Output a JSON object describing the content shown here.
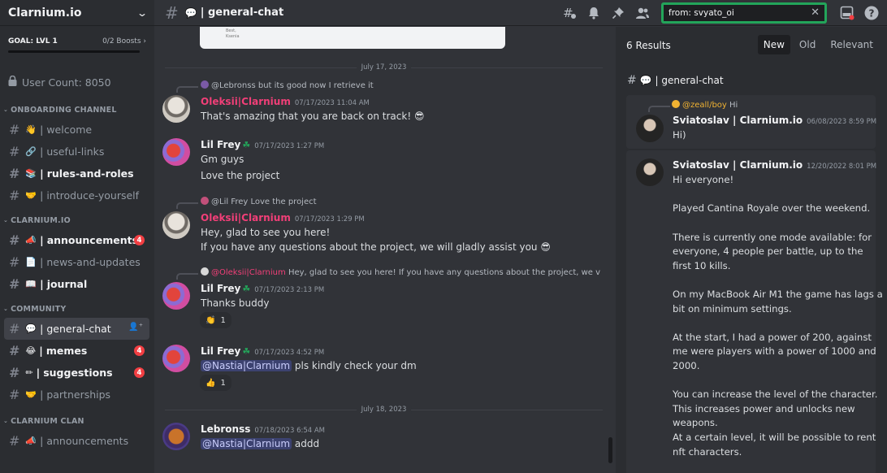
{
  "server": {
    "name": "Clarnium.io"
  },
  "goal": {
    "label": "GOAL: LVL 1",
    "boosts": "0/2 Boosts"
  },
  "user_count": "User Count: 8050",
  "categories": {
    "onboarding": "ONBOARDING CHANNEL",
    "clarnium": "CLARNIUM.IO",
    "community": "COMMUNITY",
    "clan": "CLARNIUM CLAN"
  },
  "channels": [
    {
      "emoji": "👋",
      "name": "welcome"
    },
    {
      "emoji": "🔗",
      "name": "useful-links"
    },
    {
      "emoji": "📚",
      "name": "rules-and-roles"
    },
    {
      "emoji": "🤝",
      "name": "introduce-yourself"
    },
    {
      "emoji": "📣",
      "name": "announcements",
      "badge": "4"
    },
    {
      "emoji": "📄",
      "name": "news-and-updates"
    },
    {
      "emoji": "📖",
      "name": "journal"
    },
    {
      "emoji": "💬",
      "name": "general-chat"
    },
    {
      "emoji": "😂",
      "name": "memes",
      "badge": "4"
    },
    {
      "emoji": "✏",
      "name": "suggestions",
      "badge": "4"
    },
    {
      "emoji": "🤝",
      "name": "partnerships"
    },
    {
      "emoji": "📣",
      "name": "announcements"
    }
  ],
  "topbar": {
    "channel_emoji": "💬",
    "channel_title": "| general-chat",
    "search_query": "from: svyato_oi"
  },
  "chat": {
    "embed_lines": [
      "Best,",
      "Ksenia"
    ],
    "date_1": "July 17, 2023",
    "date_2": "July 18, 2023",
    "messages": [
      {
        "reply": "@Lebronss but its good now I retrieve it",
        "author": "Oleksii|Clarnium",
        "time": "07/17/2023 11:04 AM",
        "lines": [
          "That's amazing that you are back on track! 😎"
        ]
      },
      {
        "author": "Lil Frey",
        "time": "07/17/2023 1:27 PM",
        "lines": [
          "Gm guys",
          "Love the project"
        ]
      },
      {
        "reply": "@Lil Frey Love the project",
        "author": "Oleksii|Clarnium",
        "time": "07/17/2023 1:29 PM",
        "lines": [
          "Hey, glad to see you here!",
          "If you have any questions about the project, we will gladly assist you 😎"
        ]
      },
      {
        "reply_name": "@Oleksii|Clarnium",
        "reply": "Hey, glad to see you here! If you have any questions about the project, we v",
        "author": "Lil Frey",
        "time": "07/17/2023 2:13 PM",
        "lines": [
          "Thanks buddy"
        ],
        "reaction": {
          "emoji": "👏",
          "count": "1"
        }
      },
      {
        "author": "Lil Frey",
        "time": "07/17/2023 4:52 PM",
        "mention": "@Nastia|Clarnium",
        "lines": [
          "pls kindly check your dm"
        ],
        "reaction": {
          "emoji": "👍",
          "count": "1"
        }
      },
      {
        "author": "Lebronss",
        "time": "07/18/2023 6:54 AM",
        "mention": "@Nastia|Clarnium",
        "lines": [
          "addd"
        ]
      }
    ]
  },
  "search_panel": {
    "results_count": "6 Results",
    "sort_options": [
      "New",
      "Old",
      "Relevant"
    ],
    "channel": "| general-chat",
    "results": [
      {
        "reply_name": "@zeall/boy",
        "reply_text": "Hi",
        "author": "Sviatoslav | Clarnium.io",
        "time": "06/08/2023 8:59 PM",
        "lines": [
          "Hi)"
        ]
      },
      {
        "author": "Sviatoslav | Clarnium.io",
        "time": "12/20/2022 8:01 PM",
        "lines": [
          "Hi everyone!",
          "Played Cantina Royale over the weekend.",
          "There is currently one mode available: for",
          "everyone, 4 people per battle, up to the",
          "first 10 kills.",
          "On my MacBook Air M1 the game has lags a",
          "bit on minimum settings.",
          "At the start, I had a power of 200, against",
          "me were players with a power of 1000 and",
          "2000.",
          "You can increase the level of the character.",
          "This increases power and unlocks new",
          "weapons.",
          "At a certain level, it will be possible to rent",
          "nft characters."
        ]
      }
    ]
  },
  "colors": {
    "accent_green": "#23a55a",
    "mention_red": "#f23f43",
    "oleksii": "#f23f78",
    "lil_frey": "#f2f3f5"
  }
}
